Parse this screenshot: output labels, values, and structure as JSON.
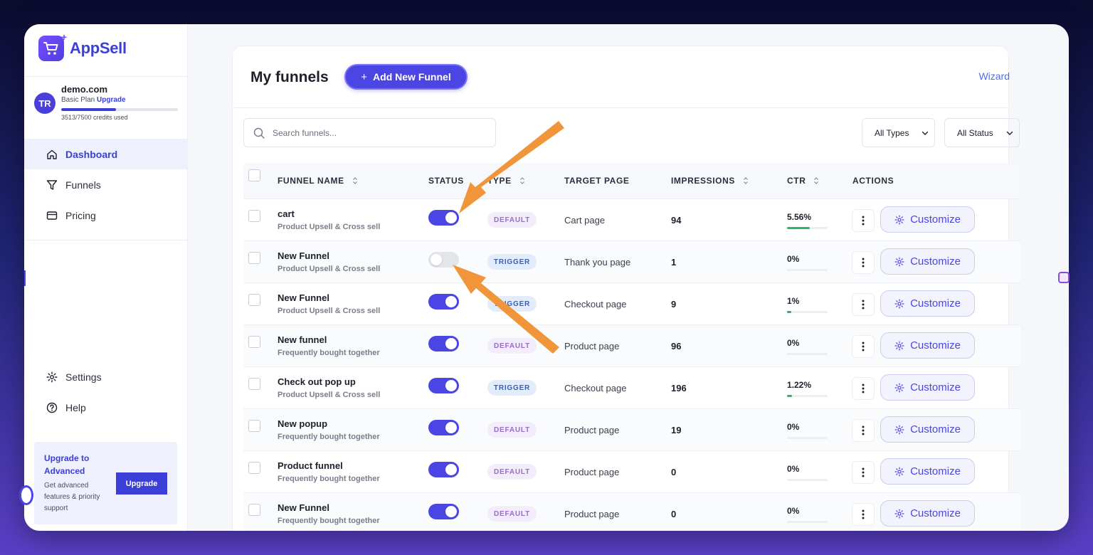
{
  "app": {
    "name": "AppSell",
    "logo_icon": "cart-icon"
  },
  "account": {
    "initials": "TR",
    "domain": "demo.com",
    "plan": "Basic Plan",
    "upgrade_link": "Upgrade",
    "credits_used": 3513,
    "credits_total": 7500,
    "credits_text": "3513/7500 credits used"
  },
  "nav": {
    "top": [
      {
        "label": "Dashboard",
        "icon": "home-icon",
        "active": true
      },
      {
        "label": "Funnels",
        "icon": "filter-icon",
        "active": false
      },
      {
        "label": "Pricing",
        "icon": "credit-card-icon",
        "active": false
      }
    ],
    "bottom": [
      {
        "label": "Settings",
        "icon": "gear-icon"
      },
      {
        "label": "Help",
        "icon": "help-circle-icon"
      }
    ]
  },
  "upgrade_card": {
    "title": "Upgrade to Advanced",
    "description": "Get advanced features & priority support",
    "button": "Upgrade"
  },
  "header": {
    "title": "My funnels",
    "add_button": "Add New Funnel",
    "wizard_link": "Wizard"
  },
  "filters": {
    "search_placeholder": "Search funnels...",
    "type_select": "All Types",
    "status_select": "All Status"
  },
  "table": {
    "columns": [
      "FUNNEL NAME",
      "STATUS",
      "TYPE",
      "TARGET PAGE",
      "IMPRESSIONS",
      "CTR",
      "ACTIONS"
    ],
    "action_label": "Customize",
    "rows": [
      {
        "name": "cart",
        "subtitle": "Product Upsell & Cross sell",
        "status_on": true,
        "type": "DEFAULT",
        "target": "Cart page",
        "impressions": "94",
        "ctr": "5.56%",
        "ctr_value": 5.56
      },
      {
        "name": "New Funnel",
        "subtitle": "Product Upsell & Cross sell",
        "status_on": false,
        "type": "TRIGGER",
        "target": "Thank you page",
        "impressions": "1",
        "ctr": "0%",
        "ctr_value": 0
      },
      {
        "name": "New Funnel",
        "subtitle": "Product Upsell & Cross sell",
        "status_on": true,
        "type": "TRIGGER",
        "target": "Checkout page",
        "impressions": "9",
        "ctr": "1%",
        "ctr_value": 1
      },
      {
        "name": "New funnel",
        "subtitle": "Frequently bought together",
        "status_on": true,
        "type": "DEFAULT",
        "target": "Product page",
        "impressions": "96",
        "ctr": "0%",
        "ctr_value": 0
      },
      {
        "name": "Check out pop up",
        "subtitle": "Product Upsell & Cross sell",
        "status_on": true,
        "type": "TRIGGER",
        "target": "Checkout page",
        "impressions": "196",
        "ctr": "1.22%",
        "ctr_value": 1.22
      },
      {
        "name": "New popup",
        "subtitle": "Frequently bought together",
        "status_on": true,
        "type": "DEFAULT",
        "target": "Product page",
        "impressions": "19",
        "ctr": "0%",
        "ctr_value": 0
      },
      {
        "name": "Product funnel",
        "subtitle": "Frequently bought together",
        "status_on": true,
        "type": "DEFAULT",
        "target": "Product page",
        "impressions": "0",
        "ctr": "0%",
        "ctr_value": 0
      },
      {
        "name": "New Funnel",
        "subtitle": "Frequently bought together",
        "status_on": true,
        "type": "DEFAULT",
        "target": "Product page",
        "impressions": "0",
        "ctr": "0%",
        "ctr_value": 0
      }
    ]
  },
  "colors": {
    "accent": "#4b45e4",
    "annotation_arrow": "#f0953a",
    "ctr_bar": "#2db36b"
  }
}
